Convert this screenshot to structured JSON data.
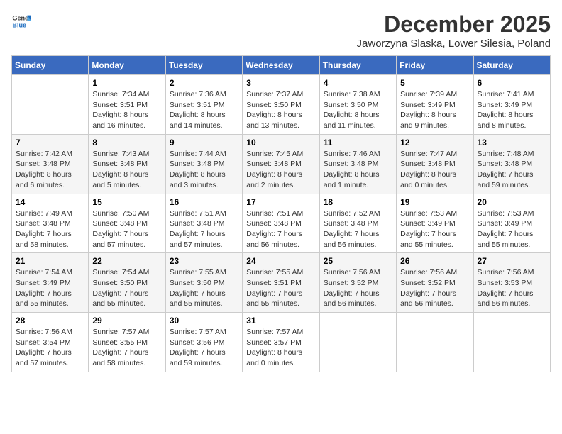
{
  "header": {
    "logo_general": "General",
    "logo_blue": "Blue",
    "month_year": "December 2025",
    "location": "Jaworzyna Slaska, Lower Silesia, Poland"
  },
  "days_of_week": [
    "Sunday",
    "Monday",
    "Tuesday",
    "Wednesday",
    "Thursday",
    "Friday",
    "Saturday"
  ],
  "weeks": [
    {
      "days": [
        {
          "num": "",
          "info": ""
        },
        {
          "num": "1",
          "info": "Sunrise: 7:34 AM\nSunset: 3:51 PM\nDaylight: 8 hours\nand 16 minutes."
        },
        {
          "num": "2",
          "info": "Sunrise: 7:36 AM\nSunset: 3:51 PM\nDaylight: 8 hours\nand 14 minutes."
        },
        {
          "num": "3",
          "info": "Sunrise: 7:37 AM\nSunset: 3:50 PM\nDaylight: 8 hours\nand 13 minutes."
        },
        {
          "num": "4",
          "info": "Sunrise: 7:38 AM\nSunset: 3:50 PM\nDaylight: 8 hours\nand 11 minutes."
        },
        {
          "num": "5",
          "info": "Sunrise: 7:39 AM\nSunset: 3:49 PM\nDaylight: 8 hours\nand 9 minutes."
        },
        {
          "num": "6",
          "info": "Sunrise: 7:41 AM\nSunset: 3:49 PM\nDaylight: 8 hours\nand 8 minutes."
        }
      ]
    },
    {
      "days": [
        {
          "num": "7",
          "info": "Sunrise: 7:42 AM\nSunset: 3:48 PM\nDaylight: 8 hours\nand 6 minutes."
        },
        {
          "num": "8",
          "info": "Sunrise: 7:43 AM\nSunset: 3:48 PM\nDaylight: 8 hours\nand 5 minutes."
        },
        {
          "num": "9",
          "info": "Sunrise: 7:44 AM\nSunset: 3:48 PM\nDaylight: 8 hours\nand 3 minutes."
        },
        {
          "num": "10",
          "info": "Sunrise: 7:45 AM\nSunset: 3:48 PM\nDaylight: 8 hours\nand 2 minutes."
        },
        {
          "num": "11",
          "info": "Sunrise: 7:46 AM\nSunset: 3:48 PM\nDaylight: 8 hours\nand 1 minute."
        },
        {
          "num": "12",
          "info": "Sunrise: 7:47 AM\nSunset: 3:48 PM\nDaylight: 8 hours\nand 0 minutes."
        },
        {
          "num": "13",
          "info": "Sunrise: 7:48 AM\nSunset: 3:48 PM\nDaylight: 7 hours\nand 59 minutes."
        }
      ]
    },
    {
      "days": [
        {
          "num": "14",
          "info": "Sunrise: 7:49 AM\nSunset: 3:48 PM\nDaylight: 7 hours\nand 58 minutes."
        },
        {
          "num": "15",
          "info": "Sunrise: 7:50 AM\nSunset: 3:48 PM\nDaylight: 7 hours\nand 57 minutes."
        },
        {
          "num": "16",
          "info": "Sunrise: 7:51 AM\nSunset: 3:48 PM\nDaylight: 7 hours\nand 57 minutes."
        },
        {
          "num": "17",
          "info": "Sunrise: 7:51 AM\nSunset: 3:48 PM\nDaylight: 7 hours\nand 56 minutes."
        },
        {
          "num": "18",
          "info": "Sunrise: 7:52 AM\nSunset: 3:48 PM\nDaylight: 7 hours\nand 56 minutes."
        },
        {
          "num": "19",
          "info": "Sunrise: 7:53 AM\nSunset: 3:49 PM\nDaylight: 7 hours\nand 55 minutes."
        },
        {
          "num": "20",
          "info": "Sunrise: 7:53 AM\nSunset: 3:49 PM\nDaylight: 7 hours\nand 55 minutes."
        }
      ]
    },
    {
      "days": [
        {
          "num": "21",
          "info": "Sunrise: 7:54 AM\nSunset: 3:49 PM\nDaylight: 7 hours\nand 55 minutes."
        },
        {
          "num": "22",
          "info": "Sunrise: 7:54 AM\nSunset: 3:50 PM\nDaylight: 7 hours\nand 55 minutes."
        },
        {
          "num": "23",
          "info": "Sunrise: 7:55 AM\nSunset: 3:50 PM\nDaylight: 7 hours\nand 55 minutes."
        },
        {
          "num": "24",
          "info": "Sunrise: 7:55 AM\nSunset: 3:51 PM\nDaylight: 7 hours\nand 55 minutes."
        },
        {
          "num": "25",
          "info": "Sunrise: 7:56 AM\nSunset: 3:52 PM\nDaylight: 7 hours\nand 56 minutes."
        },
        {
          "num": "26",
          "info": "Sunrise: 7:56 AM\nSunset: 3:52 PM\nDaylight: 7 hours\nand 56 minutes."
        },
        {
          "num": "27",
          "info": "Sunrise: 7:56 AM\nSunset: 3:53 PM\nDaylight: 7 hours\nand 56 minutes."
        }
      ]
    },
    {
      "days": [
        {
          "num": "28",
          "info": "Sunrise: 7:56 AM\nSunset: 3:54 PM\nDaylight: 7 hours\nand 57 minutes."
        },
        {
          "num": "29",
          "info": "Sunrise: 7:57 AM\nSunset: 3:55 PM\nDaylight: 7 hours\nand 58 minutes."
        },
        {
          "num": "30",
          "info": "Sunrise: 7:57 AM\nSunset: 3:56 PM\nDaylight: 7 hours\nand 59 minutes."
        },
        {
          "num": "31",
          "info": "Sunrise: 7:57 AM\nSunset: 3:57 PM\nDaylight: 8 hours\nand 0 minutes."
        },
        {
          "num": "",
          "info": ""
        },
        {
          "num": "",
          "info": ""
        },
        {
          "num": "",
          "info": ""
        }
      ]
    }
  ]
}
